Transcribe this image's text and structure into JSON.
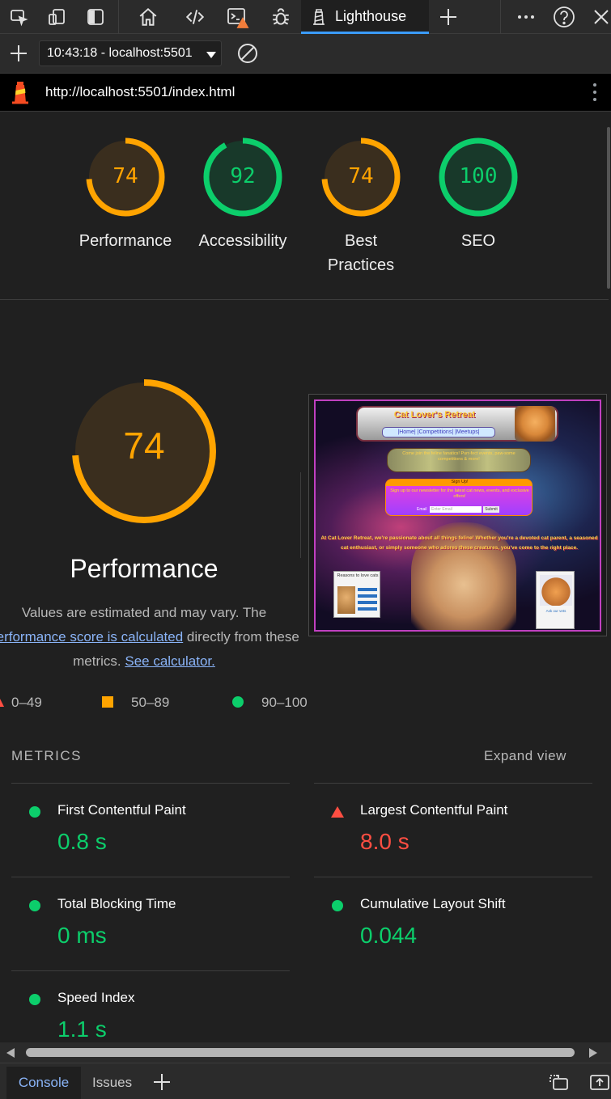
{
  "colors": {
    "orange": "#ffa400",
    "green": "#0cce6b",
    "red": "#ff4e42",
    "link": "#8ab4f8",
    "accent": "#3b9cff"
  },
  "tabbar": {
    "icons": [
      "inspect-icon",
      "device-toolbar-icon",
      "toggle-sidebar-icon",
      "home-icon",
      "elements-icon",
      "console-warning-icon",
      "bug-icon",
      "more-icon",
      "help-icon",
      "close-icon"
    ],
    "active_tab": {
      "label": "Lighthouse",
      "icon": "lighthouse-tab-icon"
    },
    "new_tab": "+"
  },
  "report_selector": {
    "value": "10:43:18 - localhost:5501"
  },
  "urlbar": {
    "url": "http://localhost:5501/index.html"
  },
  "scores": [
    {
      "category": "Performance",
      "score": 74
    },
    {
      "category": "Accessibility",
      "score": 92
    },
    {
      "category": "Best Practices",
      "score": 74
    },
    {
      "category": "SEO",
      "score": 100
    }
  ],
  "performance": {
    "score": 74,
    "title": "Performance",
    "desc_1": "Values are estimated and may vary. The",
    "desc_link1": "performance score is calculated",
    "desc_2": " directly from these",
    "desc_3": "metrics. ",
    "desc_link2": "See calculator."
  },
  "legend": {
    "fail": "0–49",
    "average": "50–89",
    "pass": "90–100"
  },
  "metrics": {
    "heading": "METRICS",
    "expand": "Expand view",
    "items": [
      {
        "name": "First Contentful Paint",
        "value": "0.8 s",
        "status": "pass"
      },
      {
        "name": "Largest Contentful Paint",
        "value": "8.0 s",
        "status": "fail"
      },
      {
        "name": "Total Blocking Time",
        "value": "0 ms",
        "status": "pass"
      },
      {
        "name": "Cumulative Layout Shift",
        "value": "0.044",
        "status": "pass"
      },
      {
        "name": "Speed Index",
        "value": "1.1 s",
        "status": "pass"
      }
    ]
  },
  "screenshot": {
    "site_title": "Cat Lover's Retreat",
    "nav": "|Home| |Competitions| |Meetups|",
    "banner": "Come join the feline fanatics! Purr-fect events, paw-some competitions & more!",
    "signup_title": "Sign Up!",
    "signup_text": "Sign up to our newsletter for the latest cat news, events, and exclusive offers!",
    "email_label": "Email",
    "email_placeholder": "Enter Email",
    "submit": "Submit",
    "intro": "At Cat Lover Retreat, we're passionate about all things feline! Whether you're a devoted cat parent, a seasoned cat enthusiast, or simply someone who adores these creatures, you've come to the right place.",
    "card_left": "Reasons to love cats",
    "card_right": "Ask our vets"
  },
  "drawer": {
    "tabs": [
      "Console",
      "Issues"
    ],
    "add": "+"
  }
}
